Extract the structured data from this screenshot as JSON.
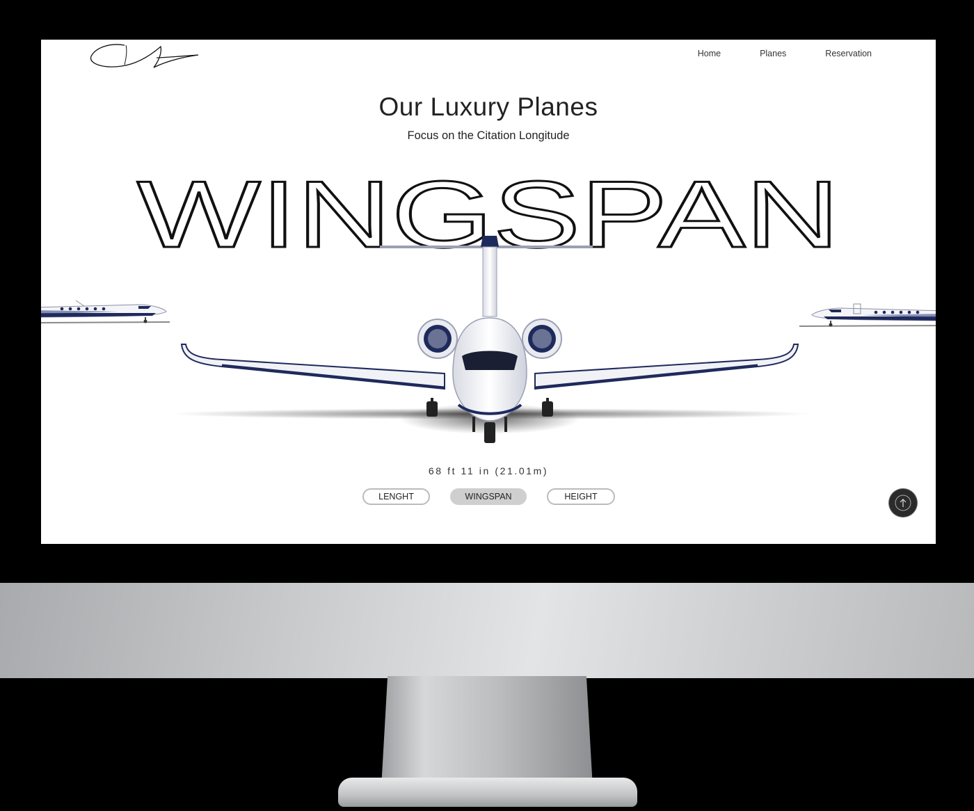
{
  "nav": {
    "items": [
      {
        "label": "Home"
      },
      {
        "label": "Planes"
      },
      {
        "label": "Reservation"
      }
    ]
  },
  "hero": {
    "title": "Our Luxury Planes",
    "subtitle": "Focus on the Citation Longitude",
    "feature_word": "WINGSPAN",
    "measurement": "68 ft 11 in (21.01m)"
  },
  "tabs": [
    {
      "label": "LENGHT",
      "active": false
    },
    {
      "label": "WINGSPAN",
      "active": true
    },
    {
      "label": "HEIGHT",
      "active": false
    }
  ],
  "icons": {
    "logo": "signature-logo",
    "scroll_top": "arrow-up-icon"
  },
  "colors": {
    "accent_navy": "#1f2a5c",
    "tab_active_bg": "#cfcfcf",
    "scroll_button_bg": "#2b2b2b"
  }
}
